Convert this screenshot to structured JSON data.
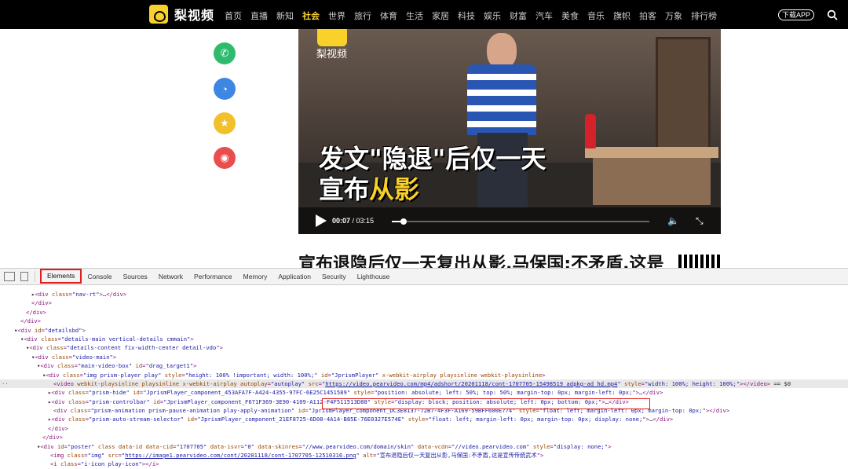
{
  "topnav": {
    "brand": "梨视频",
    "items": [
      "首页",
      "直播",
      "新知",
      "社会",
      "世界",
      "旅行",
      "体育",
      "生活",
      "家居",
      "科技",
      "娱乐",
      "财富",
      "汽车",
      "美食",
      "音乐",
      "旗帜",
      "拍客",
      "万象",
      "排行榜"
    ],
    "active": "社会",
    "download_app": "下载APP"
  },
  "share": {
    "colors": [
      "#2fbb6d",
      "#3d86e3",
      "#f2c02a",
      "#ea4d4d"
    ],
    "icons": [
      "wechat-icon",
      "qq-icon",
      "qzone-icon",
      "weibo-icon"
    ]
  },
  "video": {
    "watermark": "梨视频",
    "caption_line1": "发文\"隐退\"后仅一天",
    "caption_line2_prefix": "宣布",
    "caption_line2_highlight": "从影",
    "time_current": "00:07",
    "time_total": "/ 03:15",
    "progress": 0.045
  },
  "article_title": "宣布退隐后仅一天复出从影,马保国:不矛盾,这是",
  "devtools": {
    "tabs": [
      "Elements",
      "Console",
      "Sources",
      "Network",
      "Performance",
      "Memory",
      "Application",
      "Security",
      "Lighthouse"
    ],
    "selected_tab": "Elements"
  },
  "colors": {
    "accent": "#f8d12b",
    "devtools_highlight": "#e0211b"
  }
}
